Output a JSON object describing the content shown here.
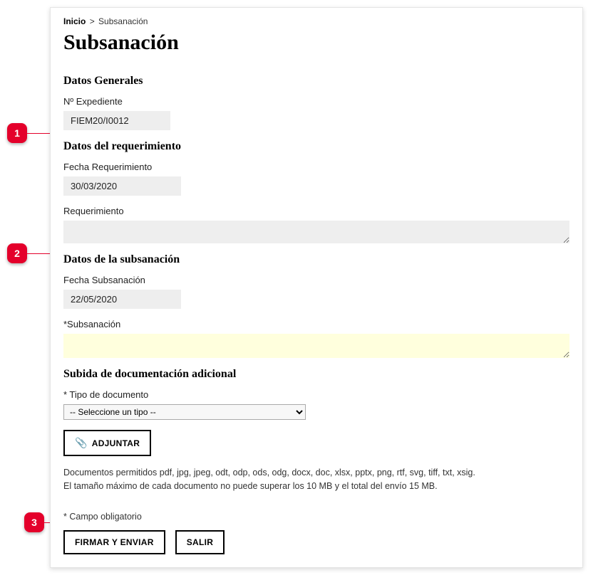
{
  "breadcrumb": {
    "home": "Inicio",
    "sep": ">",
    "current": "Subsanación"
  },
  "title": "Subsanación",
  "sections": {
    "general": {
      "heading": "Datos Generales",
      "expediente_label": "Nº Expediente",
      "expediente_value": "FIEM20/I0012"
    },
    "requerimiento": {
      "heading": "Datos del requerimiento",
      "fecha_label": "Fecha Requerimiento",
      "fecha_value": "30/03/2020",
      "req_label": "Requerimiento",
      "req_value": ""
    },
    "subsanacion": {
      "heading": "Datos de la subsanación",
      "fecha_label": "Fecha Subsanación",
      "fecha_value": "22/05/2020",
      "sub_label": "*Subsanación",
      "sub_value": ""
    },
    "docs": {
      "heading": "Subida de documentación adicional",
      "tipo_label": "* Tipo de documento",
      "tipo_placeholder": "-- Seleccione un tipo --",
      "adjuntar_label": "ADJUNTAR",
      "help_line1": "Documentos permitidos pdf, jpg, jpeg, odt, odp, ods, odg, docx, doc, xlsx, pptx, png, rtf, svg, tiff, txt, xsig.",
      "help_line2": "El tamaño máximo de cada documento no puede superar los 10 MB y el total del envío 15 MB."
    }
  },
  "mandatory_note": "* Campo obligatorio",
  "actions": {
    "submit": "FIRMAR Y ENVIAR",
    "exit": "SALIR"
  },
  "markers": {
    "m1": "1",
    "m2": "2",
    "m3": "3"
  }
}
